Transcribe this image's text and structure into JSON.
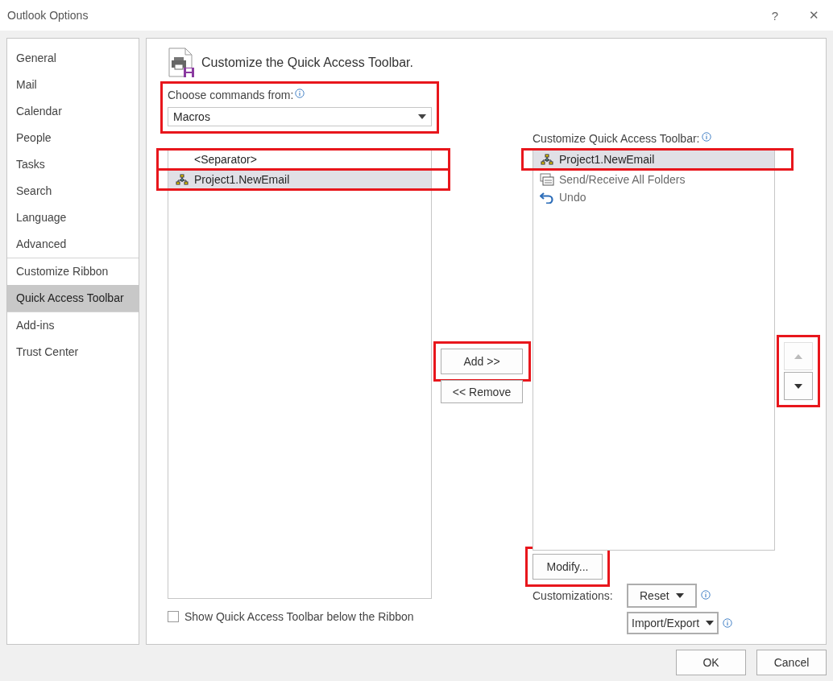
{
  "window": {
    "title": "Outlook Options",
    "help": "?",
    "close": "✕"
  },
  "sidebar": {
    "items": [
      {
        "label": "General",
        "selected": false,
        "divider_before": false
      },
      {
        "label": "Mail",
        "selected": false,
        "divider_before": false
      },
      {
        "label": "Calendar",
        "selected": false,
        "divider_before": false
      },
      {
        "label": "People",
        "selected": false,
        "divider_before": false
      },
      {
        "label": "Tasks",
        "selected": false,
        "divider_before": false
      },
      {
        "label": "Search",
        "selected": false,
        "divider_before": false
      },
      {
        "label": "Language",
        "selected": false,
        "divider_before": false
      },
      {
        "label": "Advanced",
        "selected": false,
        "divider_before": false
      },
      {
        "label": "Customize Ribbon",
        "selected": false,
        "divider_before": true
      },
      {
        "label": "Quick Access Toolbar",
        "selected": true,
        "divider_before": false
      },
      {
        "label": "Add-ins",
        "selected": false,
        "divider_before": true
      },
      {
        "label": "Trust Center",
        "selected": false,
        "divider_before": false
      }
    ]
  },
  "header": {
    "title": "Customize the Quick Access Toolbar."
  },
  "choose_commands": {
    "label": "Choose commands from:",
    "value": "Macros",
    "highlighted": true
  },
  "commands_list": {
    "items": [
      {
        "label": "<Separator>",
        "kind": "separator",
        "selected": false,
        "highlighted": true
      },
      {
        "label": "Project1.NewEmail",
        "kind": "macro",
        "selected": true,
        "highlighted": true
      }
    ]
  },
  "show_below_ribbon": {
    "label": "Show Quick Access Toolbar below the Ribbon",
    "checked": false
  },
  "add_button": {
    "label": "Add >>",
    "highlighted": true
  },
  "remove_button": {
    "label": "<< Remove",
    "highlighted": false
  },
  "toolbar_label": "Customize Quick Access Toolbar:",
  "toolbar_list": {
    "items": [
      {
        "label": "Project1.NewEmail",
        "kind": "macro",
        "selected": true,
        "highlighted": true
      },
      {
        "label": "Send/Receive All Folders",
        "kind": "sendreceive",
        "selected": false,
        "highlighted": false
      },
      {
        "label": "Undo",
        "kind": "undo",
        "selected": false,
        "highlighted": false
      }
    ]
  },
  "move_buttons": {
    "highlighted": true,
    "up_disabled": true,
    "down_disabled": false
  },
  "modify_button": {
    "label": "Modify...",
    "highlighted": true
  },
  "customizations": {
    "label": "Customizations:",
    "reset": "Reset",
    "import_export": "Import/Export"
  },
  "footer": {
    "ok": "OK",
    "cancel": "Cancel"
  }
}
